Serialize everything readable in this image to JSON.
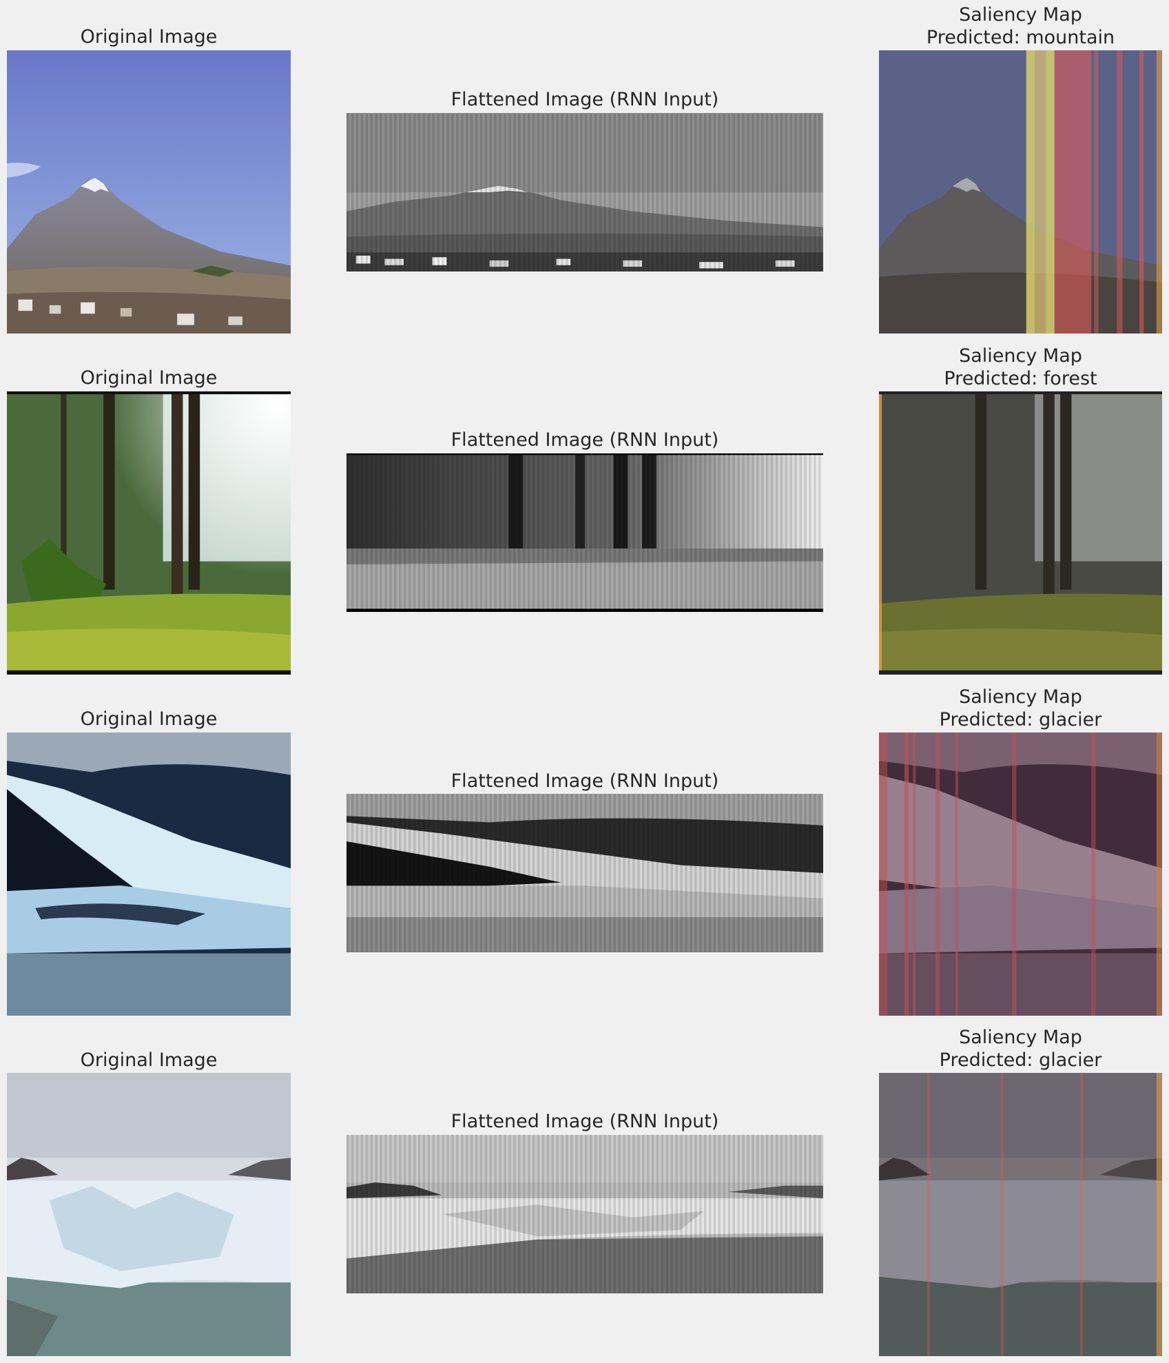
{
  "rows": [
    {
      "scene": "mountain",
      "original_title": "Original Image",
      "flattened_title": "Flattened Image (RNN Input)",
      "saliency_title": "Saliency Map",
      "saliency_prediction": "Predicted: mountain"
    },
    {
      "scene": "forest",
      "original_title": "Original Image",
      "flattened_title": "Flattened Image (RNN Input)",
      "saliency_title": "Saliency Map",
      "saliency_prediction": "Predicted: forest"
    },
    {
      "scene": "glacier",
      "original_title": "Original Image",
      "flattened_title": "Flattened Image (RNN Input)",
      "saliency_title": "Saliency Map",
      "saliency_prediction": "Predicted: glacier"
    },
    {
      "scene": "glacier2",
      "original_title": "Original Image",
      "flattened_title": "Flattened Image (RNN Input)",
      "saliency_title": "Saliency Map",
      "saliency_prediction": "Predicted: glacier"
    }
  ],
  "colors": {
    "background": "#f0f0f0",
    "text": "#262626",
    "saliency_highlight": "#e05a5a"
  }
}
